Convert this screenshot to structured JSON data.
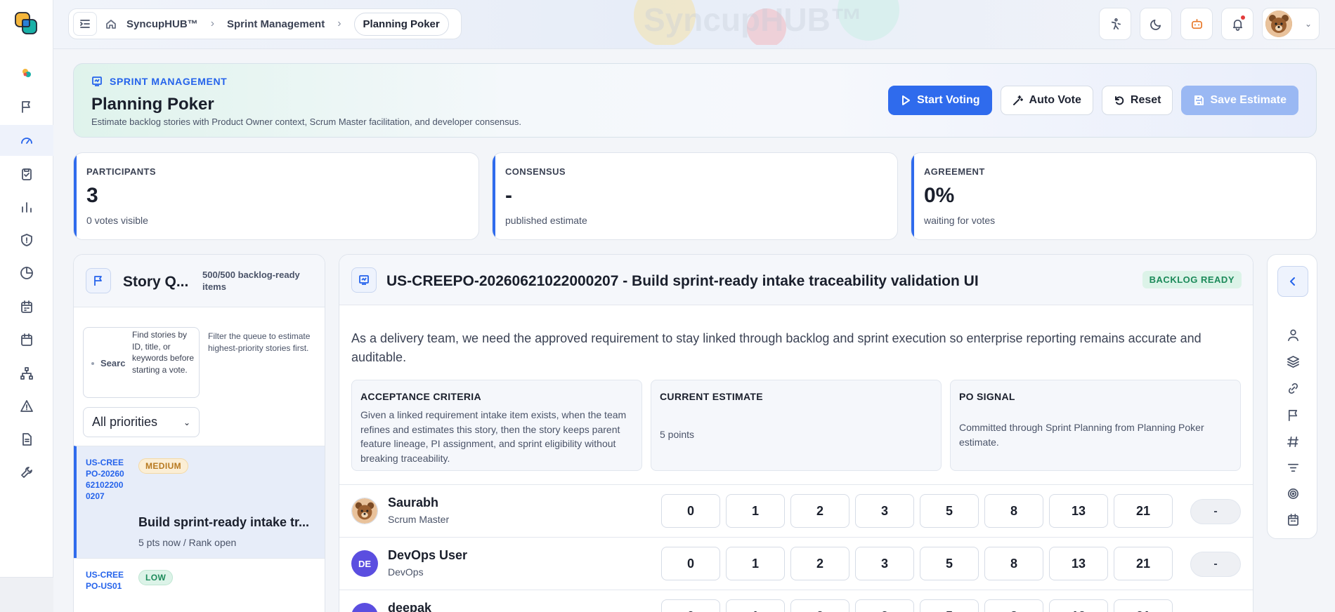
{
  "app": {
    "name": "SyncupHUB™",
    "watermark": "SyncupHUB™"
  },
  "breadcrumb": {
    "items": [
      "SyncupHUB™",
      "Sprint Management"
    ],
    "current": "Planning Poker"
  },
  "rail": {
    "icons": [
      "logo-icon",
      "flag-icon",
      "gauge-icon",
      "clipboard-icon",
      "bar-chart-icon",
      "shield-icon",
      "pie-chart-icon",
      "calendar-icon",
      "calendar-alt-icon",
      "hierarchy-icon",
      "warning-icon",
      "document-icon",
      "wrench-icon"
    ],
    "active": "gauge-icon"
  },
  "top_actions": [
    "accessibility-icon",
    "moon-icon",
    "bot-icon",
    "bell-icon"
  ],
  "hero": {
    "kicker": "SPRINT MANAGEMENT",
    "title": "Planning Poker",
    "subtitle": "Estimate backlog stories with Product Owner context, Scrum Master facilitation, and developer consensus.",
    "buttons": {
      "start": "Start Voting",
      "auto": "Auto Vote",
      "reset": "Reset",
      "save": "Save Estimate"
    }
  },
  "stats": [
    {
      "label": "PARTICIPANTS",
      "value": "3",
      "note": "0 votes visible"
    },
    {
      "label": "CONSENSUS",
      "value": "-",
      "note": "published estimate"
    },
    {
      "label": "AGREEMENT",
      "value": "0%",
      "note": "waiting for votes"
    }
  ],
  "queue": {
    "title": "Story Q...",
    "count": "500/500 backlog-ready items",
    "search_placeholder": "Searc",
    "search_help": "Find stories by ID, title, or keywords before starting a vote.",
    "hint": "Filter the queue to estimate highest-priority stories first.",
    "priority_filter": "All priorities",
    "items": [
      {
        "id": "US-CREEPO-20260621022000207",
        "priority": "MEDIUM",
        "title": "Build sprint-ready intake tr...",
        "meta": "5 pts now / Rank open"
      },
      {
        "id": "US-CREEPO-US01",
        "priority": "LOW",
        "title": "",
        "meta": ""
      }
    ]
  },
  "detail": {
    "title": "US-CREEPO-20260621022000207 - Build sprint-ready intake traceability validation UI",
    "status": "BACKLOG READY",
    "description": "As a delivery team, we need the approved requirement to stay linked through backlog and sprint execution so enterprise reporting remains accurate and auditable.",
    "cards": [
      {
        "title": "ACCEPTANCE CRITERIA",
        "body": "Given a linked requirement intake item exists, when the team refines and estimates this story, then the story keeps parent feature lineage, PI assignment, and sprint eligibility without breaking traceability."
      },
      {
        "title": "CURRENT ESTIMATE",
        "body": "5 points"
      },
      {
        "title": "PO SIGNAL",
        "body": "Committed through Sprint Planning from Planning Poker estimate."
      }
    ],
    "vote_values": [
      "0",
      "1",
      "2",
      "3",
      "5",
      "8",
      "13",
      "21"
    ],
    "participants": [
      {
        "name": "Saurabh",
        "role": "Scrum Master",
        "initials": "",
        "vote": "-"
      },
      {
        "name": "DevOps User",
        "role": "DevOps",
        "initials": "DE",
        "vote": "-"
      },
      {
        "name": "deepak",
        "role": "",
        "initials": "",
        "vote": ""
      }
    ]
  },
  "right_rail": {
    "icons": [
      "user-icon",
      "layers-icon",
      "link-icon",
      "flag-icon",
      "hash-icon",
      "filter-icon",
      "target-icon",
      "calendar-icon"
    ]
  },
  "colors": {
    "accent": "#2f6bed",
    "success": "#1c8a5a",
    "warning": "#b7791f"
  }
}
